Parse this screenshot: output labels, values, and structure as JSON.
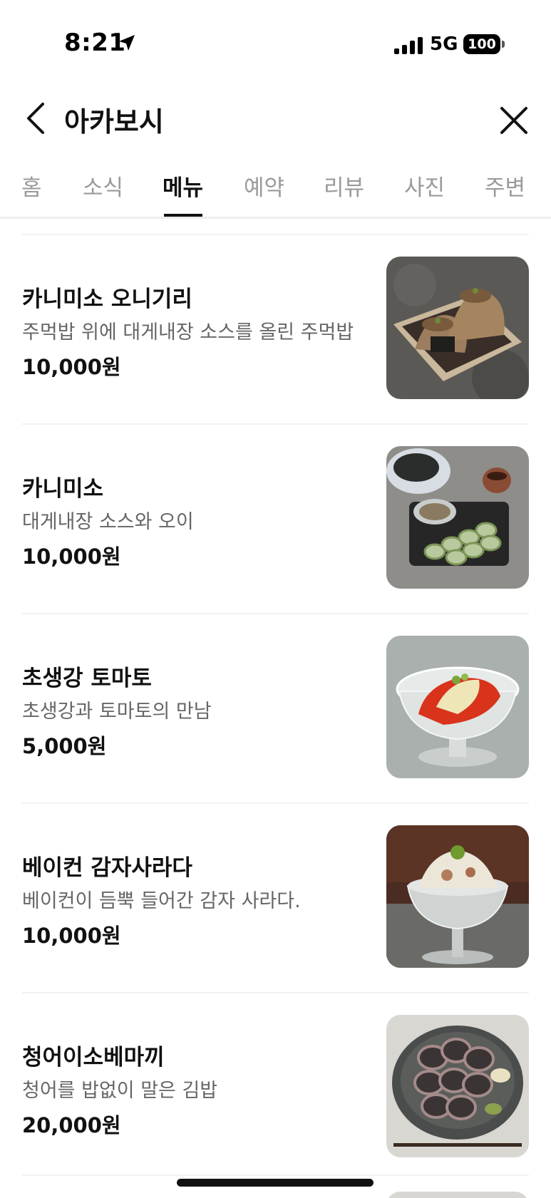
{
  "status_bar": {
    "time": "8:21",
    "network": "5G",
    "battery": "100",
    "icons": [
      "location-arrow-icon",
      "cellular-signal-icon",
      "battery-icon"
    ]
  },
  "header": {
    "title": "아카보시",
    "back_icon": "chevron-left-icon",
    "close_icon": "close-icon"
  },
  "tabs": [
    {
      "label": "홈",
      "active": false
    },
    {
      "label": "소식",
      "active": false
    },
    {
      "label": "메뉴",
      "active": true
    },
    {
      "label": "예약",
      "active": false
    },
    {
      "label": "리뷰",
      "active": false
    },
    {
      "label": "사진",
      "active": false
    },
    {
      "label": "주변",
      "active": false
    }
  ],
  "menu": {
    "items": [
      {
        "name": "카니미소 오니기리",
        "description": "주먹밥 위에 대게내장 소스를 올린 주먹밥",
        "price": "10,000원",
        "image": "crab-miso-onigiri-photo"
      },
      {
        "name": "카니미소",
        "description": "대게내장 소스와 오이",
        "price": "10,000원",
        "image": "crab-miso-cucumber-photo"
      },
      {
        "name": "초생강 토마토",
        "description": "초생강과 토마토의 만남",
        "price": "5,000원",
        "image": "pickled-ginger-tomato-photo"
      },
      {
        "name": "베이컨 감자사라다",
        "description": "베이컨이 듬뿍 들어간 감자 사라다.",
        "price": "10,000원",
        "image": "bacon-potato-salad-photo"
      },
      {
        "name": "청어이소베마끼",
        "description": "청어를 밥없이 말은 김밥",
        "price": "20,000원",
        "image": "herring-isobe-maki-photo"
      }
    ]
  },
  "colors": {
    "text_primary": "#111111",
    "text_secondary": "#666666",
    "tab_inactive": "#9a9a9a",
    "divider": "#f1f1f1"
  }
}
